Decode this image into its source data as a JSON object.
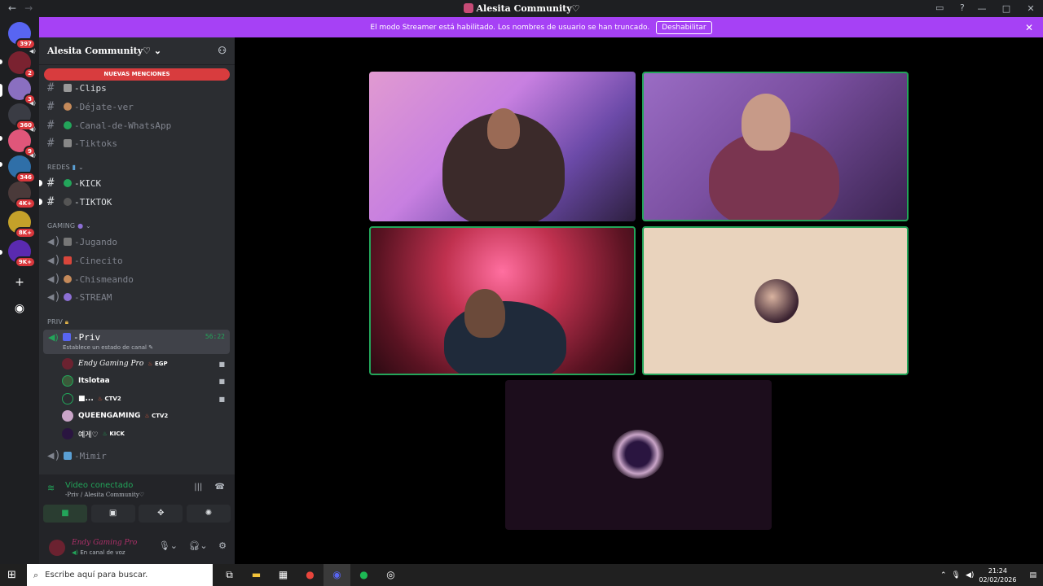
{
  "window": {
    "title": "Alesita Community♡"
  },
  "banner": {
    "text": "El modo Streamer está habilitado. Los nombres de usuario se han truncado.",
    "button": "Deshabilitar"
  },
  "servers": [
    {
      "badge": "397"
    },
    {
      "badge": "2"
    },
    {
      "badge": "3"
    },
    {
      "badge": "360"
    },
    {
      "badge": "9"
    },
    {
      "badge": "346"
    },
    {
      "badge": "4K+"
    },
    {
      "badge": "8K+"
    },
    {
      "badge": "9K+"
    }
  ],
  "guild": {
    "name": "Alesita Community♡"
  },
  "mentions_pill": "NUEVAS MENCIONES",
  "channels_top": [
    {
      "label": "-Clips"
    },
    {
      "label": "-Déjate-ver"
    },
    {
      "label": "-Canal-de-WhatsApp"
    },
    {
      "label": "-Tiktoks"
    }
  ],
  "categories": {
    "redes": "REDES",
    "gaming": "GAMING",
    "priv": "PRIV"
  },
  "redes_channels": [
    {
      "label": "-KICK"
    },
    {
      "label": "-TIKTOK"
    }
  ],
  "gaming_channels": [
    {
      "label": "-Jugando"
    },
    {
      "label": "-Cinecito"
    },
    {
      "label": "-Chismeando"
    },
    {
      "label": "-STREAM"
    }
  ],
  "priv_channel": {
    "label": "-Priv",
    "status": "Establece un estado de canal",
    "timer": "56:22"
  },
  "voice_users": [
    {
      "name": "Endy Gaming Pro",
      "tag": "EGP",
      "camera": true
    },
    {
      "name": "Itslotaa",
      "tag": "",
      "camera": true
    },
    {
      "name": "■...",
      "tag": "CTV2",
      "camera": true
    },
    {
      "name": "QUEENGAMING",
      "tag": "CTV2",
      "camera": false
    },
    {
      "name": "예게♡",
      "tag": "KICK",
      "camera": false
    }
  ],
  "mimir_channel": {
    "label": "-Mimir"
  },
  "voice_panel": {
    "status": "Video conectado",
    "location": "-Priv / Alesita Community♡"
  },
  "user_panel": {
    "name": "Endy Gaming Pro",
    "status": "En canal de voz"
  },
  "taskbar": {
    "search_placeholder": "Escribe aquí para buscar.",
    "time": "21:24",
    "date": "02/02/2026"
  }
}
